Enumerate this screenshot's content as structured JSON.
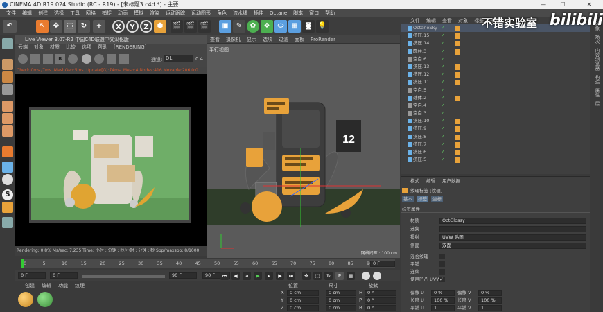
{
  "window": {
    "title": "CINEMA 4D R19.024 Studio (RC - R19) - [未标题3.c4d *] - 主要"
  },
  "menu": [
    "文件",
    "编辑",
    "创建",
    "选择",
    "工具",
    "网格",
    "捕捉",
    "动画",
    "模拟",
    "渲染",
    "运动跟踪",
    "运动图形",
    "角色",
    "流水线",
    "插件",
    "Octane",
    "脚本",
    "窗口",
    "帮助"
  ],
  "toolbar": {
    "axis_buttons": [
      "X",
      "Y",
      "Z"
    ]
  },
  "live_viewer": {
    "title": "Live Viewer 3.07-R2 中国C4D联盟中文汉化版",
    "menu": [
      "云端",
      "对象",
      "材质",
      "比较",
      "选项",
      "帮助",
      "[RENDERING]"
    ],
    "mode_label": "通道:",
    "mode_value": "DL",
    "mode_number": "0.4",
    "status": "Check:0ms./7ms. MeshGen:5ms. Update[G]:74ms. Mesh:4 Nodes:416 Movable:206 0:0",
    "footer": "Rendering: 0.8%     Ms/sec: 7.235     Time: 小时 : 分钟 : 秒/小时 : 分钟 : 秒     Spp/maxspp: 8/1000     Tri: 0"
  },
  "viewport": {
    "menu": [
      "查看",
      "摄像机",
      "显示",
      "选项",
      "过滤",
      "面板",
      "ProRender"
    ],
    "title": "平行视图",
    "grid": "网格间距 : 100 cm",
    "calendar_number": "12"
  },
  "object_manager": {
    "menu": [
      "文件",
      "编辑",
      "查看",
      "对象",
      "标签",
      "书签"
    ],
    "objects": [
      "OctaneSky",
      "挤压.15",
      "挤压.14",
      "圆柱.3",
      "空白.6",
      "挤压.13",
      "挤压.12",
      "挤压.11",
      "空白.5",
      "球体.2",
      "空白.4",
      "空白.3",
      "挤压.10",
      "挤压.9",
      "挤压.8",
      "挤压.7",
      "挤压.6",
      "挤压.5"
    ]
  },
  "attribute_manager": {
    "menu": [
      "模式",
      "编辑",
      "用户数据"
    ],
    "tag_title": "纹理标签 [纹理]",
    "tabs": [
      "基本",
      "标签",
      "坐标"
    ],
    "section": "标签属性",
    "rows": [
      {
        "label": "材质",
        "value": "OctGlossy"
      },
      {
        "label": "选集",
        "value": ""
      },
      {
        "label": "投射",
        "value": "UVW 贴图"
      },
      {
        "label": "侧面",
        "value": "双面"
      }
    ],
    "checks": [
      {
        "label": "混合纹理"
      },
      {
        "label": "平铺"
      },
      {
        "label": "连续"
      },
      {
        "label": "使用凹凸 UVW"
      }
    ],
    "offsets": [
      {
        "label": "偏移 U",
        "value": "0 %"
      },
      {
        "label": "长度 U",
        "value": "100 %"
      },
      {
        "label": "平铺 U",
        "value": "1"
      },
      {
        "label": "偏移 V",
        "value": "0 %"
      },
      {
        "label": "长度 V",
        "value": "100 %"
      },
      {
        "label": "平铺 V",
        "value": "1"
      }
    ]
  },
  "timeline": {
    "ticks": [
      "0",
      "5",
      "10",
      "15",
      "20",
      "25",
      "30",
      "35",
      "40",
      "45",
      "50",
      "55",
      "60",
      "65",
      "70",
      "75",
      "80",
      "85",
      "90"
    ],
    "frame_end": "0 F",
    "start_field": "0 F",
    "current_field": "0 F",
    "end_field": "90 F",
    "max_field": "90 F"
  },
  "material_manager": {
    "menu": [
      "创建",
      "编辑",
      "功能",
      "纹理"
    ]
  },
  "coordinates": {
    "headers": [
      "位置",
      "尺寸",
      "旋转"
    ],
    "rows": [
      {
        "axis": "X",
        "pos": "0 cm",
        "size": "0 cm",
        "rot_axis": "H",
        "rot": "0 °"
      },
      {
        "axis": "Y",
        "pos": "0 cm",
        "size": "0 cm",
        "rot_axis": "P",
        "rot": "0 °"
      },
      {
        "axis": "Z",
        "pos": "0 cm",
        "size": "0 cm",
        "rot_axis": "B",
        "rot": "0 °"
      }
    ]
  },
  "right_tabs": [
    "对象",
    "场次",
    "内容浏览器",
    "构造",
    "属性",
    "层"
  ],
  "watermark": {
    "text": "不错实验室",
    "logo": "bilibili"
  },
  "colors": {
    "accent": "#e8a23a",
    "render_bg": "#6fae68",
    "status_red": "#d4572b"
  }
}
